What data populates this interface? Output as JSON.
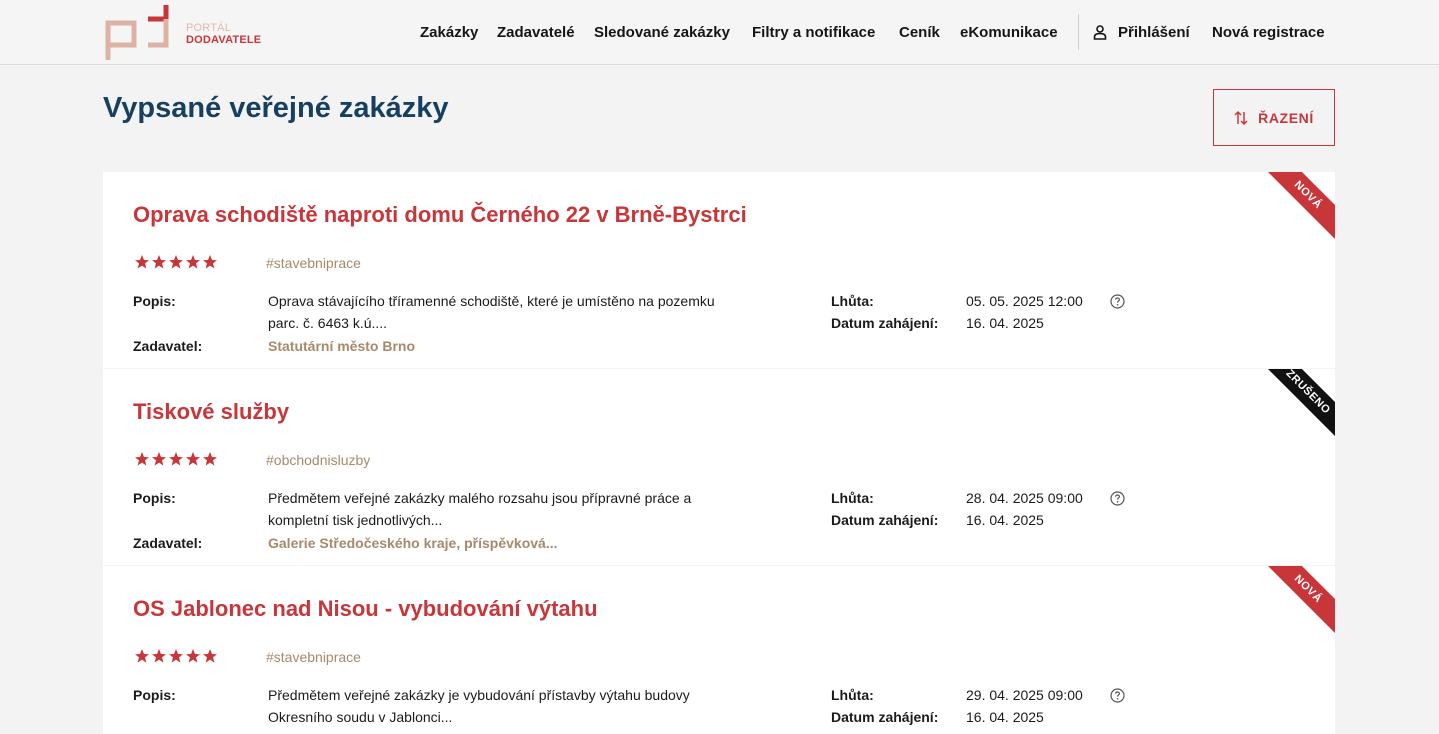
{
  "logo": {
    "line1": "PORTÁL",
    "line2": "DODAVATELE"
  },
  "nav": {
    "items": [
      "Zakázky",
      "Zadavatelé",
      "Sledované zakázky",
      "Filtry a notifikace",
      "Ceník",
      "eKomunikace"
    ],
    "login": "Přihlášení",
    "register": "Nová registrace"
  },
  "page": {
    "title": "Vypsané veřejné zakázky",
    "sort_label": "ŘAZENÍ"
  },
  "labels": {
    "description": "Popis:",
    "issuer": "Zadavatel:",
    "deadline": "Lhůta:",
    "start": "Datum zahájení:"
  },
  "cards": [
    {
      "title": "Oprava schodiště naproti domu Černého 22 v Brně-Bystrci",
      "rating": 5,
      "tag": "#stavebniprace",
      "desc_line1": "Oprava stávajícího tříramenné schodiště, které je umístěno na pozemku",
      "desc_line2": "parc. č. 6463 k.ú....",
      "issuer": "Statutární město Brno",
      "deadline": "05. 05. 2025 12:00",
      "start": "16. 04. 2025",
      "ribbon": "NOVÁ"
    },
    {
      "title": "Tiskové služby",
      "rating": 5,
      "tag": "#obchodnisluzby",
      "desc_line1": "Předmětem veřejné zakázky malého rozsahu jsou přípravné práce a",
      "desc_line2": "kompletní tisk jednotlivých...",
      "issuer": "Galerie Středočeského kraje, příspěvková...",
      "deadline": "28. 04. 2025 09:00",
      "start": "16. 04. 2025",
      "ribbon": "ZRUŠENO"
    },
    {
      "title": "OS Jablonec nad Nisou - vybudování výtahu",
      "rating": 5,
      "tag": "#stavebniprace",
      "desc_line1": "Předmětem veřejné zakázky je vybudování přístavby výtahu budovy",
      "desc_line2": "Okresního soudu v Jablonci...",
      "issuer": "",
      "deadline": "29. 04. 2025 09:00",
      "start": "16. 04. 2025",
      "ribbon": "NOVÁ"
    }
  ],
  "colors": {
    "accent": "#c9363a",
    "title": "#173f5f",
    "tag": "#a7896b"
  }
}
